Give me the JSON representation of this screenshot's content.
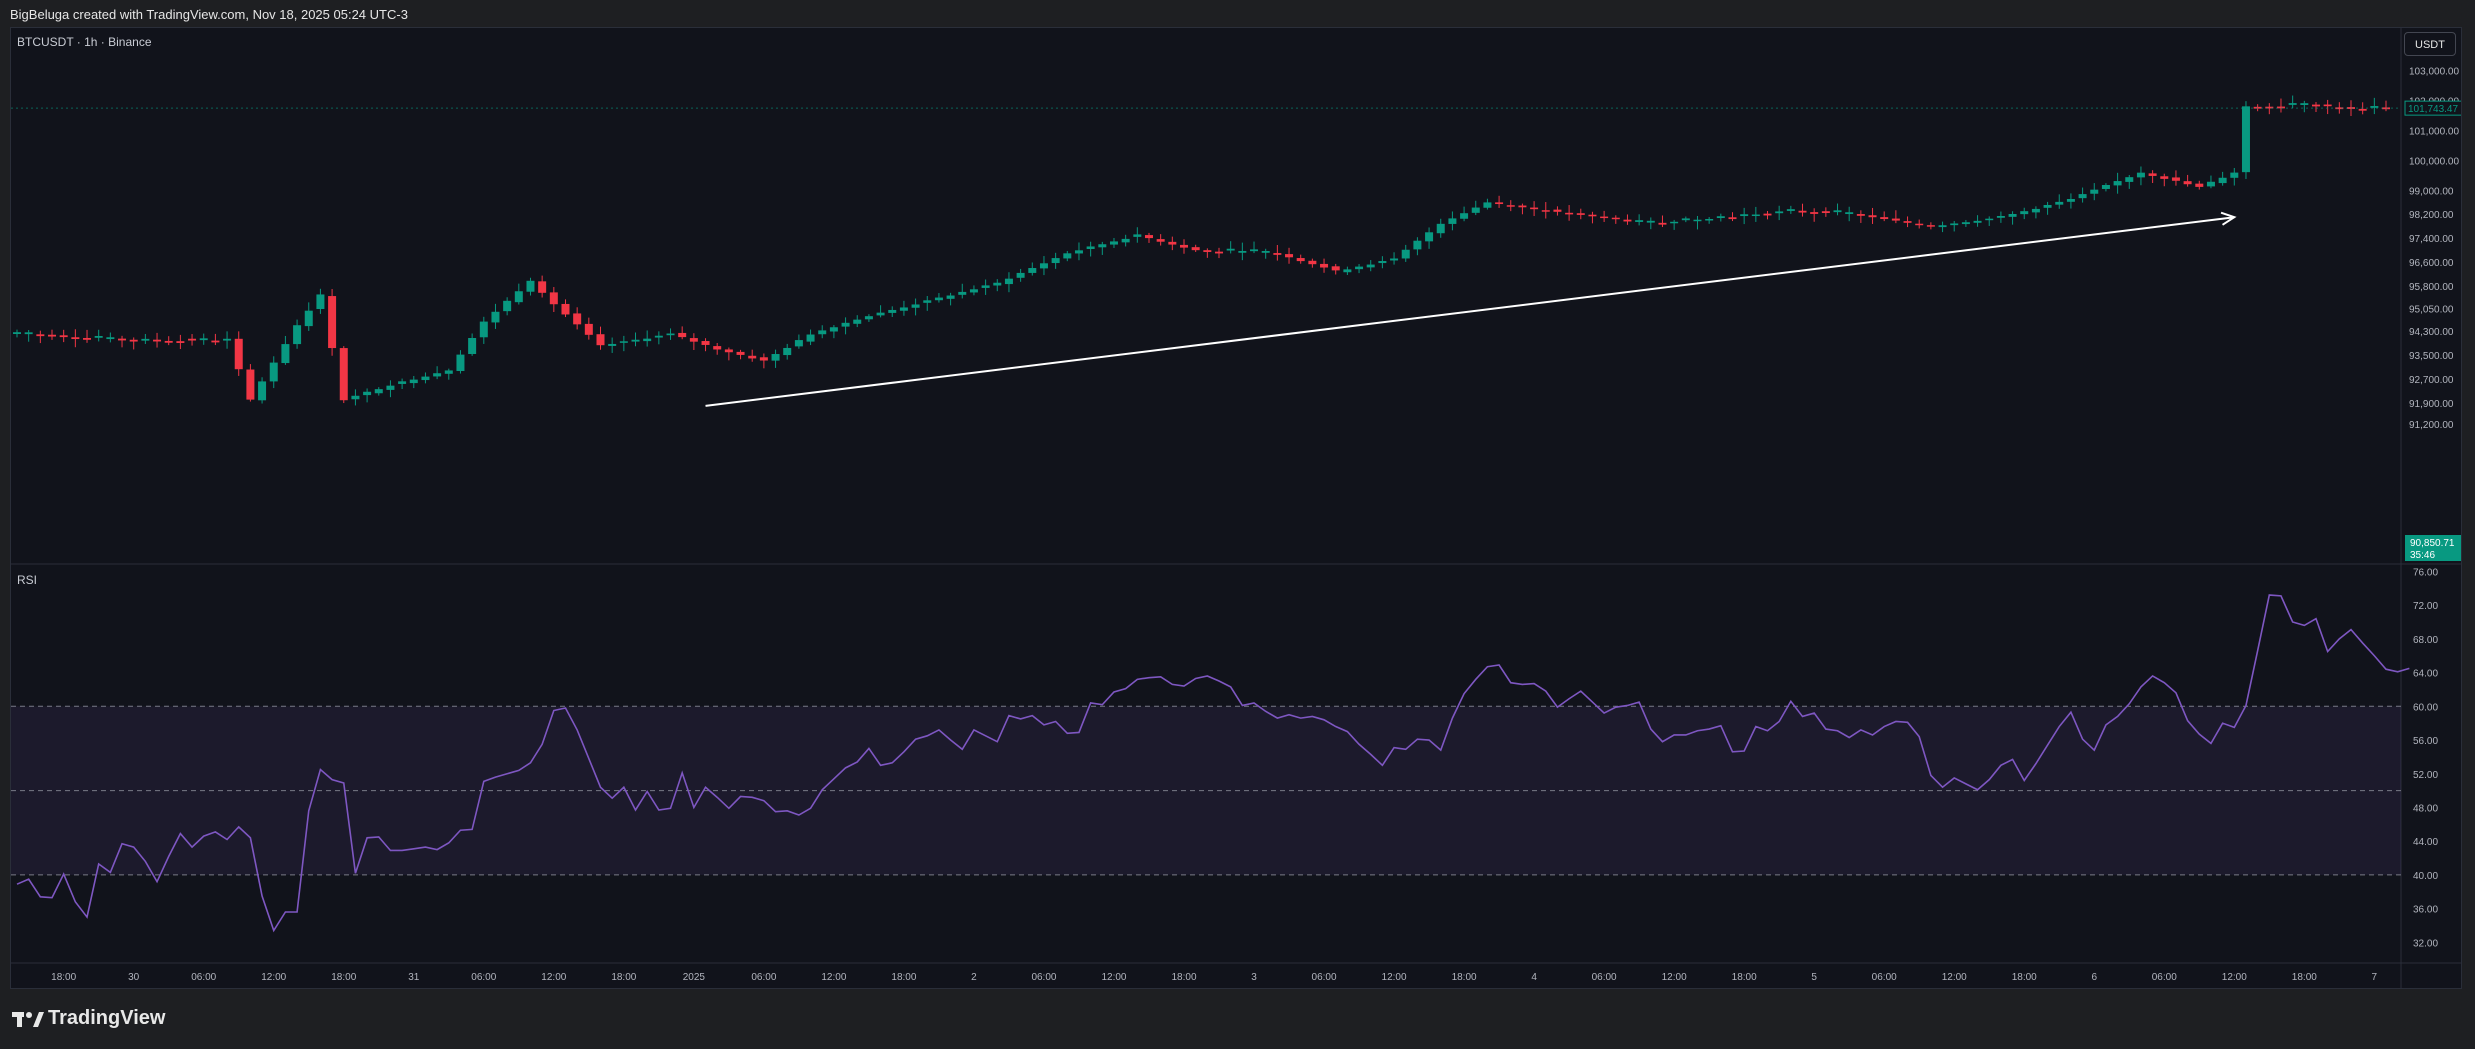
{
  "header": {
    "attribution": "BigBeluga created with TradingView.com, Nov 18, 2025 05:24 UTC-3"
  },
  "chart": {
    "symbol_label": "BTCUSDT · 1h · Binance",
    "currency_button": "USDT",
    "rsi_label": "RSI",
    "brand": "TradingView"
  },
  "colors": {
    "background": "#11131b",
    "up": "#089981",
    "down": "#f23645",
    "rsi_line": "#7e57c2",
    "rsi_band": "#7e57c2",
    "arrow": "#ffffff",
    "axis_text": "#b2b5be"
  },
  "chart_data": [
    {
      "type": "candlestick",
      "title": "BTCUSDT · 1h · Binance",
      "ylim": [
        91000,
        103400
      ],
      "y_ticks": [
        "103,000.00",
        "102,000.00",
        "101,000.00",
        "100,000.00",
        "99,000.00",
        "98,200.00",
        "97,400.00",
        "96,600.00",
        "95,800.00",
        "95,050.00",
        "94,300.00",
        "93,500.00",
        "92,700.00",
        "91,900.00",
        "91,200.00"
      ],
      "y_tick_values": [
        103000,
        102000,
        101000,
        100000,
        99000,
        98200,
        97400,
        96600,
        95800,
        95050,
        94300,
        93500,
        92700,
        91900,
        91200
      ],
      "x_ticks": [
        "18:00",
        "30",
        "06:00",
        "12:00",
        "18:00",
        "31",
        "06:00",
        "12:00",
        "18:00",
        "2025",
        "06:00",
        "12:00",
        "18:00",
        "2",
        "06:00",
        "12:00",
        "18:00",
        "3",
        "06:00",
        "12:00",
        "18:00",
        "4",
        "06:00",
        "12:00",
        "18:00",
        "5",
        "06:00",
        "12:00",
        "18:00",
        "6",
        "06:00",
        "12:00",
        "18:00",
        "7"
      ],
      "x_tick_hours": [
        4,
        10,
        16,
        22,
        28,
        34,
        40,
        46,
        52,
        58,
        64,
        70,
        76,
        82,
        88,
        94,
        100,
        106,
        112,
        118,
        124,
        130,
        136,
        142,
        148,
        154,
        160,
        166,
        172,
        178,
        184,
        190,
        196,
        202
      ],
      "price_labels": {
        "last_price": "101,743.47",
        "low_label": "90,850.71",
        "countdown": "35:46"
      },
      "key_levels": [
        {
          "hour": 0,
          "price": 94200
        },
        {
          "hour": 10,
          "price": 94000
        },
        {
          "hour": 18,
          "price": 94000
        },
        {
          "hour": 20,
          "price": 92000
        },
        {
          "hour": 24,
          "price": 94500
        },
        {
          "hour": 26,
          "price": 95500
        },
        {
          "hour": 28,
          "price": 92000
        },
        {
          "hour": 32,
          "price": 92500
        },
        {
          "hour": 37,
          "price": 93000
        },
        {
          "hour": 40,
          "price": 94600
        },
        {
          "hour": 44,
          "price": 96000
        },
        {
          "hour": 46,
          "price": 95200
        },
        {
          "hour": 50,
          "price": 93800
        },
        {
          "hour": 56,
          "price": 94200
        },
        {
          "hour": 60,
          "price": 93700
        },
        {
          "hour": 64,
          "price": 93300
        },
        {
          "hour": 68,
          "price": 94200
        },
        {
          "hour": 72,
          "price": 94700
        },
        {
          "hour": 78,
          "price": 95300
        },
        {
          "hour": 84,
          "price": 95900
        },
        {
          "hour": 90,
          "price": 96900
        },
        {
          "hour": 96,
          "price": 97500
        },
        {
          "hour": 101,
          "price": 97000
        },
        {
          "hour": 108,
          "price": 96900
        },
        {
          "hour": 113,
          "price": 96300
        },
        {
          "hour": 118,
          "price": 96700
        },
        {
          "hour": 122,
          "price": 97900
        },
        {
          "hour": 126,
          "price": 98600
        },
        {
          "hour": 133,
          "price": 98200
        },
        {
          "hour": 140,
          "price": 97900
        },
        {
          "hour": 146,
          "price": 98100
        },
        {
          "hour": 152,
          "price": 98300
        },
        {
          "hour": 157,
          "price": 98200
        },
        {
          "hour": 164,
          "price": 97800
        },
        {
          "hour": 170,
          "price": 98100
        },
        {
          "hour": 176,
          "price": 98700
        },
        {
          "hour": 182,
          "price": 99600
        },
        {
          "hour": 187,
          "price": 99100
        },
        {
          "hour": 190,
          "price": 99600
        },
        {
          "hour": 191,
          "price": 101800
        },
        {
          "hour": 196,
          "price": 101900
        },
        {
          "hour": 200,
          "price": 101700
        },
        {
          "hour": 203,
          "price": 101743
        }
      ],
      "trend_arrow": {
        "from": {
          "hour": 59,
          "price": 91800
        },
        "to": {
          "hour": 190,
          "price": 98100
        }
      }
    },
    {
      "type": "line",
      "title": "RSI",
      "ylim": [
        30,
        77
      ],
      "y_ticks": [
        "76.00",
        "72.00",
        "68.00",
        "64.00",
        "60.00",
        "56.00",
        "52.00",
        "48.00",
        "44.00",
        "40.00",
        "36.00",
        "32.00"
      ],
      "y_tick_values": [
        76,
        72,
        68,
        64,
        60,
        56,
        52,
        48,
        44,
        40,
        36,
        32
      ],
      "bands": {
        "upper": 60,
        "middle": 50,
        "lower": 40
      },
      "x_hours_start": 0,
      "values": [
        38.9,
        39.5,
        37.4,
        37.3,
        40.1,
        36.8,
        35.0,
        41.3,
        40.3,
        43.7,
        43.3,
        41.6,
        39.2,
        42.2,
        44.9,
        43.3,
        44.6,
        45.1,
        44.2,
        45.7,
        44.4,
        37.5,
        33.4,
        35.6,
        35.6,
        47.6,
        52.5,
        51.3,
        50.9,
        40.2,
        44.4,
        44.5,
        42.9,
        42.9,
        43.1,
        43.3,
        43.0,
        43.8,
        45.3,
        45.4,
        51.1,
        51.6,
        52.0,
        52.4,
        53.3,
        55.5,
        59.5,
        59.8,
        57.2,
        53.8,
        50.4,
        49.1,
        50.4,
        47.7,
        49.9,
        47.7,
        47.9,
        52.1,
        48.0,
        50.4,
        49.2,
        47.9,
        49.3,
        49.2,
        48.8,
        47.5,
        47.6,
        47.1,
        47.9,
        50.1,
        51.4,
        52.7,
        53.4,
        55.0,
        53.0,
        53.3,
        54.6,
        56.1,
        56.5,
        57.2,
        56.0,
        54.9,
        57.2,
        56.5,
        55.8,
        58.9,
        58.5,
        58.9,
        57.8,
        58.2,
        56.8,
        56.9,
        60.4,
        60.2,
        61.7,
        62.1,
        63.2,
        63.4,
        63.5,
        62.6,
        62.4,
        63.3,
        63.6,
        63.0,
        62.3,
        60.1,
        60.4,
        59.4,
        58.6,
        59.0,
        58.6,
        58.8,
        58.4,
        57.6,
        57.0,
        55.5,
        54.3,
        53.0,
        55.1,
        54.9,
        56.1,
        56.0,
        54.8,
        58.6,
        61.5,
        63.2,
        64.7,
        64.9,
        62.8,
        62.6,
        62.7,
        61.8,
        59.9,
        60.9,
        61.8,
        60.5,
        59.2,
        59.9,
        60.1,
        60.5,
        57.3,
        55.8,
        56.6,
        56.6,
        57.1,
        57.3,
        57.7,
        54.6,
        54.7,
        57.6,
        57.1,
        58.2,
        60.6,
        58.8,
        59.2,
        57.3,
        57.1,
        56.3,
        57.2,
        56.6,
        57.6,
        58.2,
        58.1,
        56.4,
        51.8,
        50.4,
        51.5,
        50.8,
        50.1,
        51.3,
        53.0,
        53.7,
        51.2,
        53.2,
        55.4,
        57.6,
        59.3,
        56.1,
        54.8,
        57.8,
        58.8,
        60.3,
        62.3,
        63.6,
        62.8,
        61.6,
        58.3,
        56.7,
        55.6,
        58.0,
        57.5,
        60.1,
        66.6,
        73.2,
        73.1,
        70.0,
        69.6,
        70.4,
        66.5,
        68.0,
        69.1,
        67.5,
        66.0,
        64.4,
        64.1,
        64.5
      ]
    }
  ]
}
